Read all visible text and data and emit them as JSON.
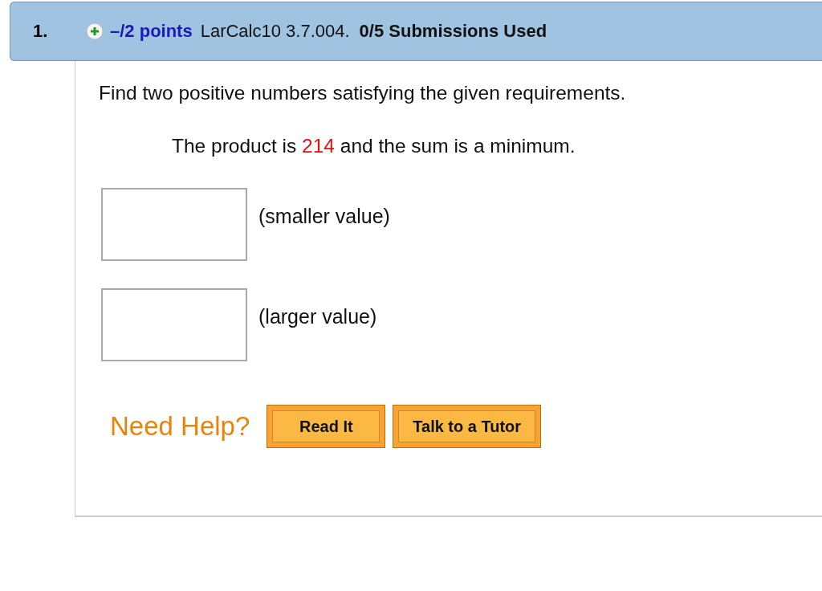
{
  "question": {
    "number": "1.",
    "points": "–/2 points",
    "source": "LarCalc10 3.7.004.",
    "submissions": "0/5 Submissions Used"
  },
  "prompt": "Find two positive numbers satisfying the given requirements.",
  "requirement": {
    "before": "The product is ",
    "value": "214",
    "after": " and the sum is a minimum."
  },
  "answers": [
    {
      "label": "(smaller value)"
    },
    {
      "label": "(larger value)"
    }
  ],
  "help": {
    "label": "Need Help?",
    "buttons": [
      "Read It",
      "Talk to a Tutor"
    ]
  }
}
